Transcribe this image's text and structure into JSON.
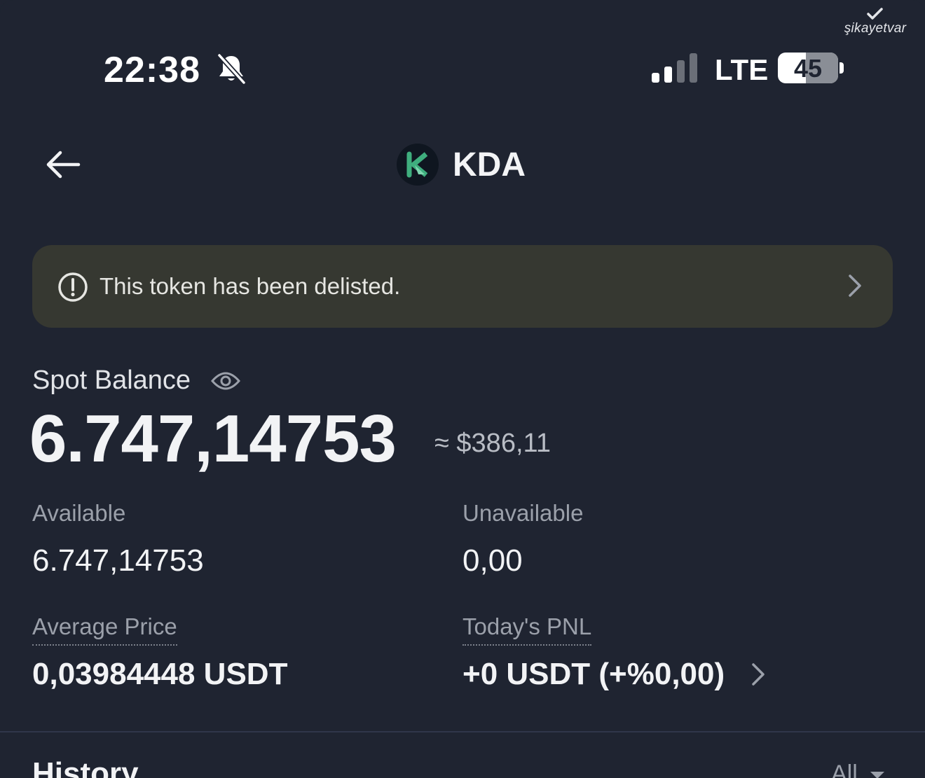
{
  "watermark": {
    "text": "şikayetvar"
  },
  "status_bar": {
    "time": "22:38",
    "network": "LTE",
    "battery": "45",
    "silent_mode": true
  },
  "header": {
    "title": "KDA",
    "logo_letter": "K"
  },
  "banner": {
    "text": "This token has been delisted."
  },
  "balance": {
    "label": "Spot Balance",
    "amount": "6.747,14753",
    "fiat": "≈ $386,11"
  },
  "stats": {
    "available_label": "Available",
    "available_value": "6.747,14753",
    "unavailable_label": "Unavailable",
    "unavailable_value": "0,00",
    "avg_price_label": "Average Price",
    "avg_price_value": "0,03984448 USDT",
    "pnl_label": "Today's PNL",
    "pnl_value": "+0 USDT (+%0,00)"
  },
  "history": {
    "title": "History",
    "filter": "All"
  },
  "colors": {
    "background": "#1f2431",
    "banner": "#363831",
    "logo_accent": "#3fae7e"
  }
}
